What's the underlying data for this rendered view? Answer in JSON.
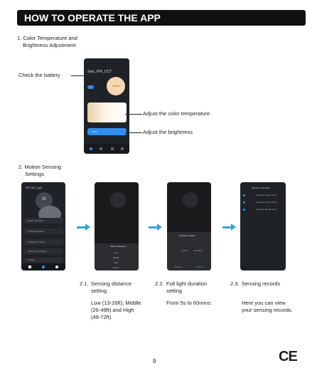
{
  "header": {
    "title": "HOW TO OPERATE THE APP"
  },
  "section1": {
    "title_line1": "1. Color Temperature and",
    "title_line2": "Brightness Adjustment",
    "callout_battery": "Check the battery",
    "callout_color": "Adjust the color temperature",
    "callout_brightness": "Adjust the brightness",
    "phone": {
      "device_name": "Solo_PIR_CCT",
      "temp_value": "3000K",
      "brightness_value": "100%"
    }
  },
  "section2": {
    "title_line1": "2. Motion Sensing",
    "title_line2": "Settings",
    "phone1": {
      "device_name": "PIR_DM_Light",
      "menu": [
        "Motion Detection",
        "Full light duration",
        "Intelligent Linkage",
        "Induction recording",
        "Timing"
      ]
    },
    "phone2": {
      "sheet_title": "Motion Detection",
      "options": [
        "Low",
        "Middle",
        "High"
      ],
      "cancel": "Cancel"
    },
    "phone3": {
      "sheet_title": "Full light duration",
      "left": "5s Min",
      "right": "60s Max",
      "cancel": "Cancel",
      "confirm": "Confirm"
    },
    "phone4": {
      "title": "Induction recording",
      "records": [
        "Detected human body",
        "Detected human body",
        "Detected human body"
      ]
    },
    "steps": [
      {
        "num": "2.1.",
        "title_line1": "Sensing distance",
        "title_line2": "setting",
        "desc": [
          "Low (13-26ft), Middle",
          "(26-49ft) and High",
          "(49-72ft)."
        ]
      },
      {
        "num": "2.2.",
        "title_line1": "Full light duration",
        "title_line2": "setting",
        "desc": [
          "From 5s to 60mins."
        ]
      },
      {
        "num": "2.3.",
        "title_line1": "Sensing records",
        "title_line2": "",
        "desc": [
          "Here you can view",
          "your sensing records."
        ]
      }
    ]
  },
  "footer": {
    "page_number": "9",
    "mark": "CE"
  }
}
